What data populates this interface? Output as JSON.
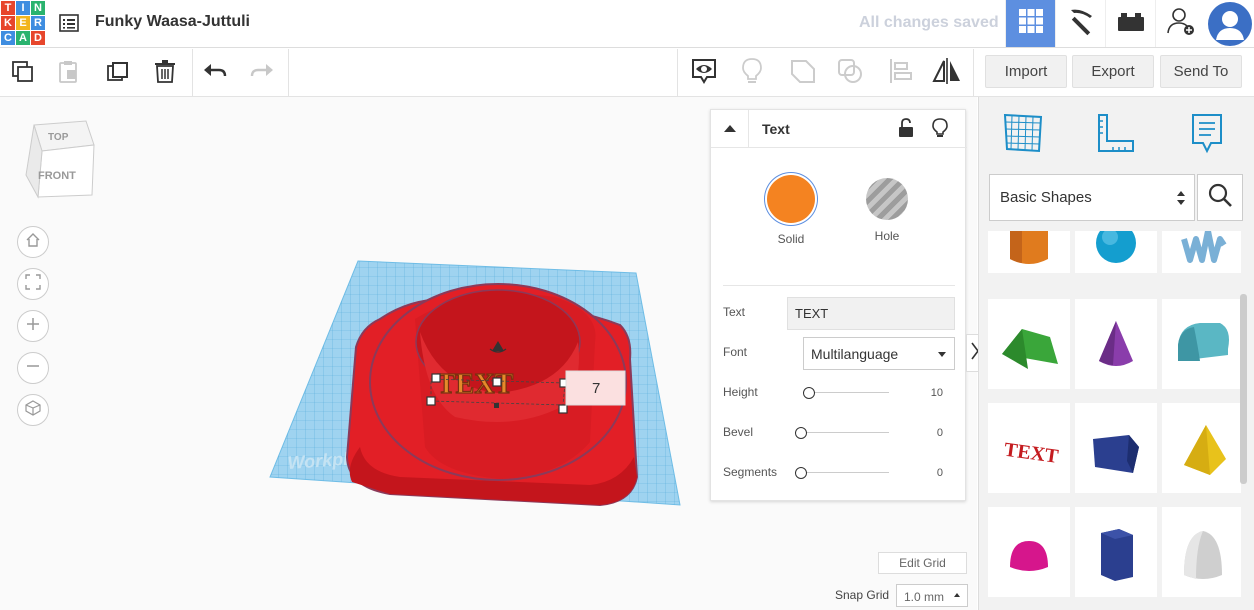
{
  "logo": {
    "letters": [
      "T",
      "I",
      "N",
      "K",
      "E",
      "R",
      "C",
      "A",
      "D"
    ],
    "colors": [
      "#e7462c",
      "#3e8de0",
      "#2ab36e",
      "#e7462c",
      "#f2b51c",
      "#3e8de0",
      "#3e8de0",
      "#2ab36e",
      "#e7462c"
    ]
  },
  "header": {
    "design_title": "Funky Waasa-Juttuli",
    "save_status": "All changes saved",
    "views": [
      "3d-grid-icon",
      "blocks-pickaxe-icon",
      "bricks-icon",
      "add-user-icon"
    ],
    "accent": "#5d8fe0"
  },
  "toolbar": {
    "tools": [
      "copy-icon",
      "paste-icon",
      "duplicate-icon",
      "delete-icon",
      "undo-icon",
      "redo-icon"
    ],
    "right_tools": [
      "notes-view-icon",
      "lightbulb-icon",
      "group-icon",
      "ungroup-icon",
      "align-icon",
      "mirror-icon"
    ],
    "import_label": "Import",
    "export_label": "Export",
    "send_label": "Send To"
  },
  "viewcube": {
    "top_label": "TOP",
    "front_label": "FRONT"
  },
  "nav": [
    "home-icon",
    "fit-view-icon",
    "zoom-in-icon",
    "zoom-out-icon",
    "perspective-icon"
  ],
  "scene": {
    "workplane_label": "Workplane",
    "dimension_value": "7",
    "text_shape": "TEXT",
    "object_color": "#e21f26",
    "grid_color": "#7fc4e8"
  },
  "inspector": {
    "title": "Text",
    "solid_label": "Solid",
    "hole_label": "Hole",
    "solid_color": "#f48321",
    "text_label": "Text",
    "text_value": "TEXT",
    "font_label": "Font",
    "font_value": "Multilanguage",
    "height_label": "Height",
    "height_value": "10",
    "height_level": 0,
    "bevel_label": "Bevel",
    "bevel_value": "0",
    "bevel_level": 0,
    "segments_label": "Segments",
    "segments_value": "0",
    "segments_level": 0
  },
  "grid_controls": {
    "edit_grid_label": "Edit Grid",
    "snap_label": "Snap Grid",
    "snap_value": "1.0 mm"
  },
  "library": {
    "top_icons": [
      "workplane-icon",
      "ruler-icon",
      "notes-icon"
    ],
    "category": "Basic Shapes",
    "shapes": [
      "cylinder",
      "sphere",
      "scribble",
      "roof",
      "cone",
      "round-roof",
      "text",
      "prism",
      "pyramid",
      "half-sphere",
      "hexagonal-prism",
      "paraboloid"
    ]
  }
}
